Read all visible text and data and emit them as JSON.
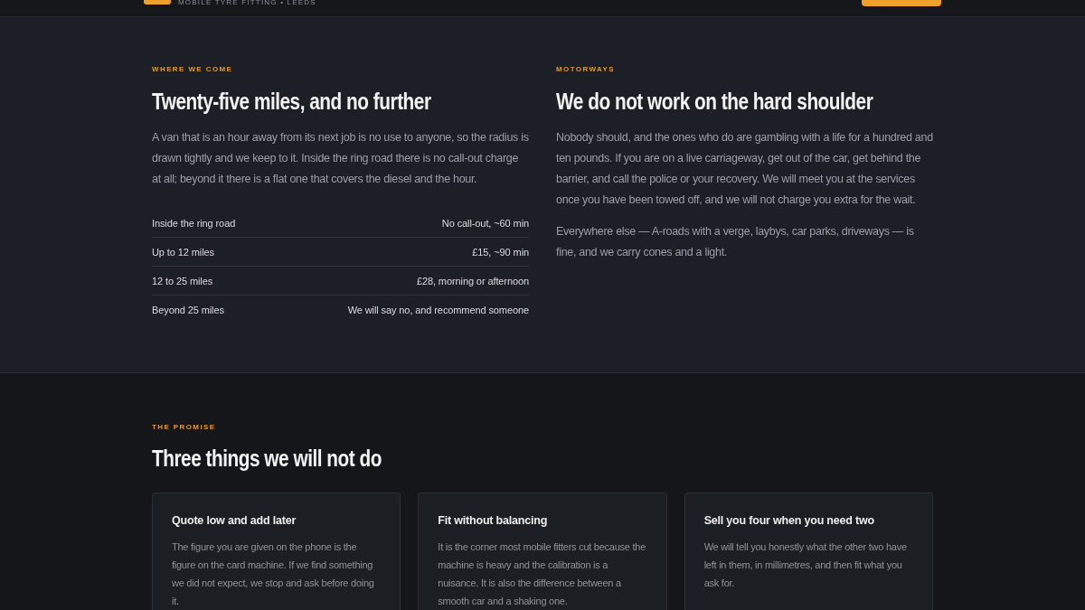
{
  "header": {
    "tagline": "MOBILE TYRE FITTING • LEEDS"
  },
  "coverage": {
    "columns": [
      {
        "eyebrow": "WHERE WE COME",
        "heading": "Twenty-five miles, and no further",
        "paragraphs": [
          "A van that is an hour away from its next job is no use to anyone, so the radius is drawn tightly and we keep to it. Inside the ring road there is no call-out charge at all; beyond it there is a flat one that covers the diesel and the hour."
        ],
        "table": {
          "rows": [
            {
              "distance": "Inside the ring road",
              "charge": "No call-out, ~60 min"
            },
            {
              "distance": "Up to 12 miles",
              "charge": "£15, ~90 min"
            },
            {
              "distance": "12 to 25 miles",
              "charge": "£28, morning or afternoon"
            },
            {
              "distance": "Beyond 25 miles",
              "charge": "We will say no, and recommend someone"
            }
          ]
        }
      },
      {
        "eyebrow": "MOTORWAYS",
        "heading": "We do not work on the hard shoulder",
        "paragraphs": [
          "Nobody should, and the ones who do are gambling with a life for a hundred and ten pounds. If you are on a live carriageway, get out of the car, get behind the barrier, and call the police or your recovery. We will meet you at the services once you have been towed off, and we will not charge you extra for the wait.",
          "Everywhere else — A-roads with a verge, laybys, car parks, driveways — is fine, and we carry cones and a light."
        ]
      }
    ]
  },
  "promise": {
    "eyebrow": "THE PROMISE",
    "heading": "Three things we will not do",
    "cards": [
      {
        "title": "Quote low and add later",
        "text": "The figure you are given on the phone is the figure on the card machine. If we find something we did not expect, we stop and ask before doing it."
      },
      {
        "title": "Fit without balancing",
        "text": "It is the corner most mobile fitters cut because the machine is heavy and the calibration is a nuisance. It is also the difference between a smooth car and a shaking one."
      },
      {
        "title": "Sell you four when you need two",
        "text": "We will tell you honestly what the other two have left in them, in millimetres, and then fit what you ask for."
      }
    ]
  }
}
